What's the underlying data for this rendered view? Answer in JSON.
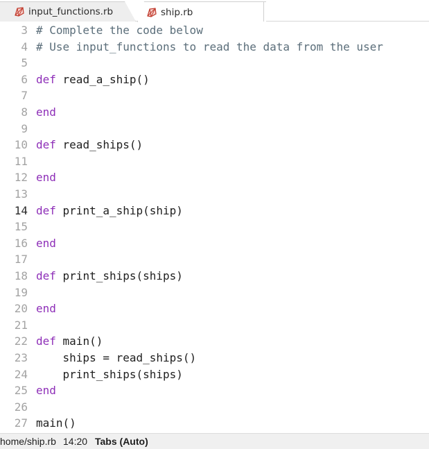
{
  "tabs": [
    {
      "label": "input_functions.rb",
      "active": false,
      "icon": "ruby-file-icon"
    },
    {
      "label": "ship.rb",
      "active": true,
      "icon": "ruby-file-icon"
    }
  ],
  "editor": {
    "current_line": 14,
    "lines": [
      {
        "num": "3",
        "tokens": [
          {
            "t": "comment",
            "v": "# Complete the code below"
          }
        ]
      },
      {
        "num": "4",
        "tokens": [
          {
            "t": "comment",
            "v": "# Use input_functions to read the data from the user"
          }
        ]
      },
      {
        "num": "5",
        "tokens": []
      },
      {
        "num": "6",
        "tokens": [
          {
            "t": "keyword",
            "v": "def"
          },
          {
            "t": "plain",
            "v": " read_a_ship()"
          }
        ]
      },
      {
        "num": "7",
        "tokens": []
      },
      {
        "num": "8",
        "tokens": [
          {
            "t": "keyword",
            "v": "end"
          }
        ]
      },
      {
        "num": "9",
        "tokens": []
      },
      {
        "num": "10",
        "tokens": [
          {
            "t": "keyword",
            "v": "def"
          },
          {
            "t": "plain",
            "v": " read_ships()"
          }
        ]
      },
      {
        "num": "11",
        "tokens": []
      },
      {
        "num": "12",
        "tokens": [
          {
            "t": "keyword",
            "v": "end"
          }
        ]
      },
      {
        "num": "13",
        "tokens": []
      },
      {
        "num": "14",
        "tokens": [
          {
            "t": "keyword",
            "v": "def"
          },
          {
            "t": "plain",
            "v": " print_a_ship(ship)"
          }
        ]
      },
      {
        "num": "15",
        "tokens": []
      },
      {
        "num": "16",
        "tokens": [
          {
            "t": "keyword",
            "v": "end"
          }
        ]
      },
      {
        "num": "17",
        "tokens": []
      },
      {
        "num": "18",
        "tokens": [
          {
            "t": "keyword",
            "v": "def"
          },
          {
            "t": "plain",
            "v": " print_ships(ships)"
          }
        ]
      },
      {
        "num": "19",
        "tokens": []
      },
      {
        "num": "20",
        "tokens": [
          {
            "t": "keyword",
            "v": "end"
          }
        ]
      },
      {
        "num": "21",
        "tokens": []
      },
      {
        "num": "22",
        "tokens": [
          {
            "t": "keyword",
            "v": "def"
          },
          {
            "t": "plain",
            "v": " main()"
          }
        ]
      },
      {
        "num": "23",
        "tokens": [
          {
            "t": "plain",
            "v": "    ships = read_ships()"
          }
        ]
      },
      {
        "num": "24",
        "tokens": [
          {
            "t": "plain",
            "v": "    print_ships(ships)"
          }
        ]
      },
      {
        "num": "25",
        "tokens": [
          {
            "t": "keyword",
            "v": "end"
          }
        ]
      },
      {
        "num": "26",
        "tokens": []
      },
      {
        "num": "27",
        "tokens": [
          {
            "t": "plain",
            "v": "main()"
          }
        ]
      }
    ]
  },
  "statusbar": {
    "path": "home/ship.rb",
    "position": "14:20",
    "indent": "Tabs (Auto)"
  },
  "colors": {
    "comment": "#5b6e7a",
    "keyword": "#8e2fb8",
    "ruby_icon": "#c0392b"
  }
}
